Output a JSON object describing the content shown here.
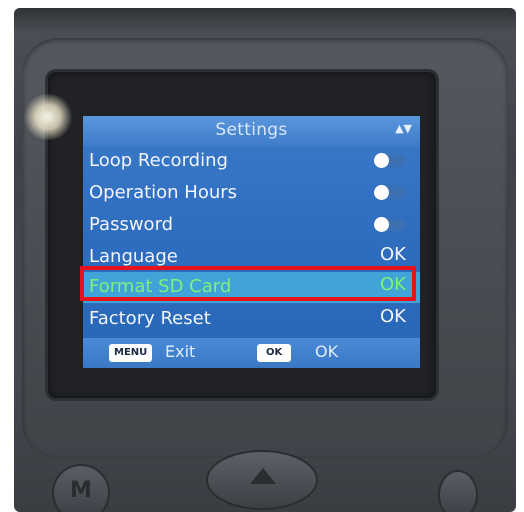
{
  "screen": {
    "title": "Settings",
    "scroll_indicator": "▲▼",
    "items": [
      {
        "label": "Loop Recording",
        "type": "toggle",
        "state": "off"
      },
      {
        "label": "Operation Hours",
        "type": "toggle",
        "state": "off"
      },
      {
        "label": "Password",
        "type": "toggle",
        "state": "off"
      },
      {
        "label": "Language",
        "type": "action",
        "value": "OK"
      },
      {
        "label": "Format SD Card",
        "type": "action",
        "value": "OK",
        "selected": true
      },
      {
        "label": "Factory Reset",
        "type": "action",
        "value": "OK"
      }
    ],
    "footer": {
      "menu_key": "MENU",
      "menu_action": "Exit",
      "ok_key": "OK",
      "ok_action": "OK"
    }
  },
  "device": {
    "m_button_label": "M"
  },
  "colors": {
    "screen_blue": "#2f6dbf",
    "selected_row": "#41a4d8",
    "selected_text": "#7ff07a",
    "highlight_border": "#e8121d"
  }
}
